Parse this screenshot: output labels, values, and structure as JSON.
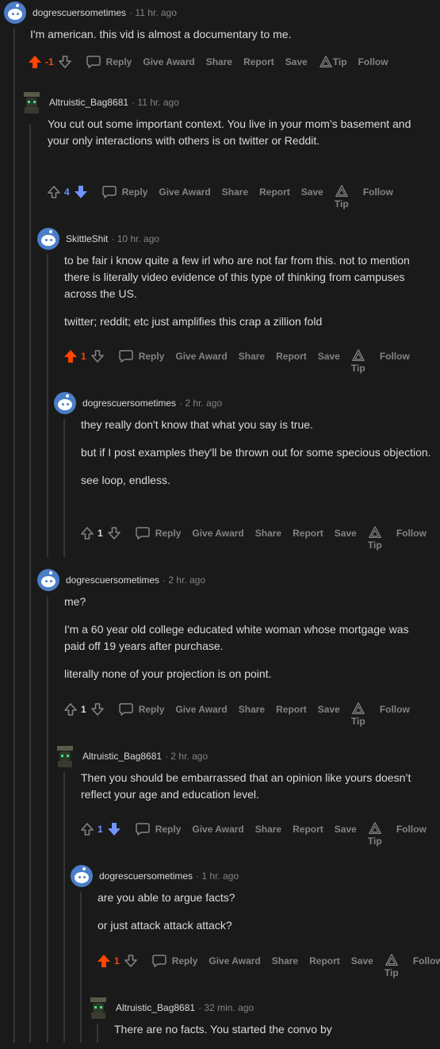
{
  "labels": {
    "reply": "Reply",
    "give_award": "Give Award",
    "share": "Share",
    "report": "Report",
    "save": "Save",
    "tip": "Tip",
    "follow": "Follow"
  },
  "colors": {
    "upvote": "#ff4500",
    "downvote": "#7193ff",
    "neutral": "#818384",
    "background": "#1a1a1b"
  },
  "comments": [
    {
      "user": "dogrescuersometimes",
      "time": "11 hr. ago",
      "avatar": "snoo-icon",
      "vote": "up",
      "score": "-1",
      "body": [
        "I'm american. this vid is almost a documentary to me."
      ]
    },
    {
      "user": "Altruistic_Bag8681",
      "time": "11 hr. ago",
      "avatar": "robot-icon",
      "vote": "down",
      "score": "4",
      "body": [
        "You cut out some important context. You live in your mom’s basement and your only interactions with others is on twitter or Reddit."
      ]
    },
    {
      "user": "SkittleShit",
      "time": "10 hr. ago",
      "avatar": "snoo-icon",
      "vote": "up",
      "score": "1",
      "body": [
        "to be fair i know quite a few irl who are not far from this. not to mention there is literally video evidence of this type of thinking from campuses across the US.",
        "twitter; reddit; etc just amplifies this crap a zillion fold"
      ]
    },
    {
      "user": "dogrescuersometimes",
      "time": "2 hr. ago",
      "avatar": "snoo-icon",
      "vote": "none",
      "score": "1",
      "body": [
        "they really don't know that what you say is true.",
        "but if I post examples they'll be thrown out for some specious objection.",
        "see loop, endless."
      ]
    },
    {
      "user": "dogrescuersometimes",
      "time": "2 hr. ago",
      "avatar": "snoo-icon",
      "vote": "none",
      "score": "1",
      "body": [
        "me?",
        "I'm a 60 year old college educated white woman whose mortgage was paid off 19 years after purchase.",
        "literally none of your projection is on point."
      ]
    },
    {
      "user": "Altruistic_Bag8681",
      "time": "2 hr. ago",
      "avatar": "robot-icon",
      "vote": "down",
      "score": "1",
      "body": [
        "Then you should be embarrassed that an opinion like yours doesn’t reflect your age and education level."
      ]
    },
    {
      "user": "dogrescuersometimes",
      "time": "1 hr. ago",
      "avatar": "snoo-icon",
      "vote": "up",
      "score": "1",
      "body": [
        "are you able to argue facts?",
        "or just attack attack attack?"
      ]
    },
    {
      "user": "Altruistic_Bag8681",
      "time": "32 min. ago",
      "avatar": "robot-icon",
      "vote": "none",
      "score": "",
      "body": [
        "There are no facts. You started the convo by"
      ]
    }
  ]
}
